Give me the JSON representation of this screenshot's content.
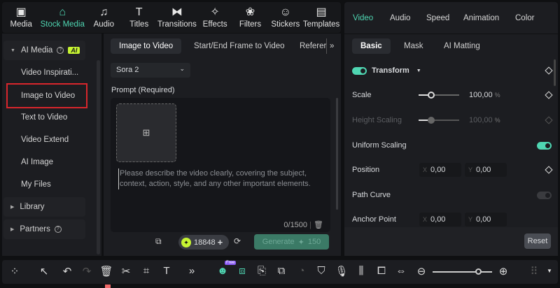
{
  "toolbar": [
    {
      "label": "Media",
      "icon": "▣"
    },
    {
      "label": "Stock Media",
      "icon": "⌂"
    },
    {
      "label": "Audio",
      "icon": "♫"
    },
    {
      "label": "Titles",
      "icon": "T"
    },
    {
      "label": "Transitions",
      "icon": "⧓"
    },
    {
      "label": "Effects",
      "icon": "✧"
    },
    {
      "label": "Filters",
      "icon": "❀"
    },
    {
      "label": "Stickers",
      "icon": "☺"
    },
    {
      "label": "Templates",
      "icon": "▤"
    }
  ],
  "sidebar": {
    "ai_media": "AI Media",
    "ai_badge": "AI",
    "help": "?",
    "items": [
      "Video Inspirati...",
      "Image to Video",
      "Text to Video",
      "Video Extend",
      "AI Image",
      "My Files"
    ],
    "library": "Library",
    "partners": "Partners"
  },
  "main": {
    "tabs": [
      "Image to Video",
      "Start/End Frame to Video",
      "Referer"
    ],
    "more": "»",
    "model": "Sora 2",
    "prompt_label": "Prompt (Required)",
    "placeholder": "Please describe the video clearly, covering the subject, context, action, style, and any other important elements.",
    "counter": "0/1500",
    "credits": "18848",
    "generate": "Generate",
    "cost": "150"
  },
  "panel": {
    "tabs": [
      "Video",
      "Audio",
      "Speed",
      "Animation",
      "Color"
    ],
    "subtabs": [
      "Basic",
      "Mask",
      "AI Matting"
    ],
    "transform": "Transform",
    "scale": "Scale",
    "scale_val": "100,00",
    "height_scaling": "Height Scaling",
    "height_val": "100,00",
    "pct": "%",
    "uniform": "Uniform Scaling",
    "position": "Position",
    "path_curve": "Path Curve",
    "anchor": "Anchor Point",
    "x": "X",
    "y": "Y",
    "zero": "0,00",
    "reset": "Reset",
    "scale_level": 0.2
  },
  "timeline": {
    "free_badge": "Free",
    "zoom_level": 0.75
  },
  "colors": {
    "accent": "#4fd6b2",
    "selection": "#d8262c",
    "ai_badge": "#c6f432"
  }
}
